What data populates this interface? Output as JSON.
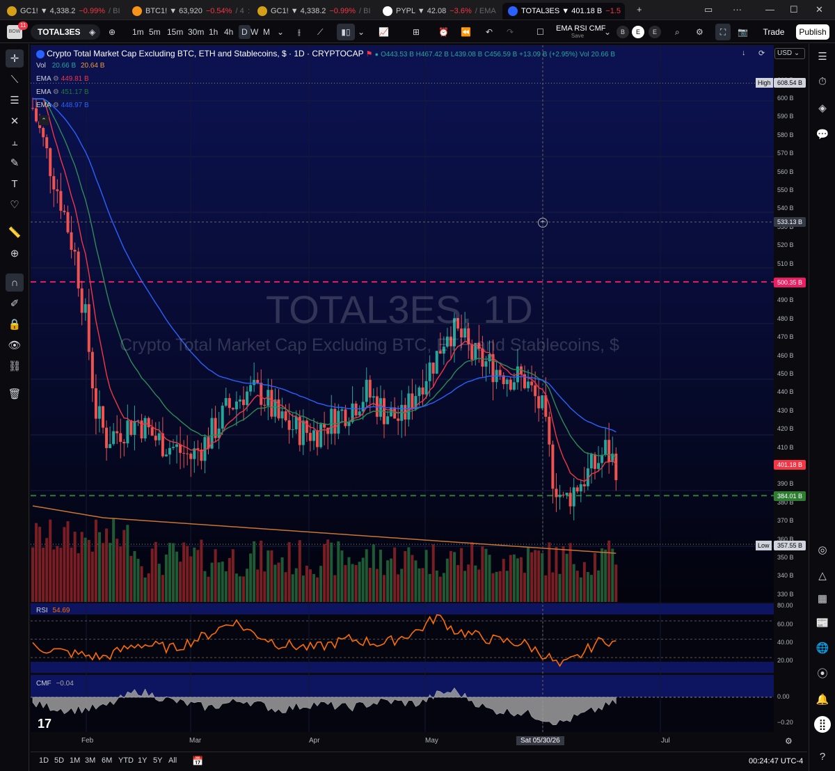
{
  "browser_tabs": [
    {
      "label": "GC1!",
      "price": "4,338.2",
      "change": "−0.99%",
      "extra": "/ BI",
      "color": "#d4a017",
      "active": false
    },
    {
      "label": "BTC1!",
      "price": "63,920",
      "change": "−0.54%",
      "extra": "/ 4",
      "color": "#f7931a",
      "active": false
    },
    {
      "label": "GC1!",
      "price": "4,338.2",
      "change": "−0.99%",
      "extra": "/ BI",
      "color": "#d4a017",
      "active": false
    },
    {
      "label": "PYPL",
      "price": "42.08",
      "change": "−3.6%",
      "extra": "/ EMA",
      "color": "#ffffff",
      "active": false
    },
    {
      "label": "TOTAL3ES",
      "price": "401.18 B",
      "change": "−1.5",
      "extra": "",
      "color": "#2962ff",
      "active": true
    }
  ],
  "toolbar": {
    "avatar_badge": "11",
    "symbol": "TOTAL3ES",
    "intervals": [
      "1m",
      "5m",
      "15m",
      "30m",
      "1h",
      "4h",
      "D",
      "W",
      "M"
    ],
    "active_interval": "D",
    "template_name": "EMA RSI CMF",
    "template_sub": "Save",
    "btn_b": "B",
    "btn_e": "E",
    "trade_label": "Trade",
    "publish_label": "Publish",
    "currency": "USD"
  },
  "legend": {
    "title": "Crypto Total Market Cap Excluding BTC, ETH and Stablecoins, $ · 1D · CRYPTOCAP",
    "ohlc": "O443.53 B  H467.42 B  L439.08 B  C456.59 B  +13.09 B (+2.95%)  Vol 20.66 B",
    "vol_label": "Vol",
    "vol_values": [
      "20.66 B",
      "20.64 B"
    ],
    "ema": [
      {
        "label": "EMA",
        "value": "449.81 B",
        "color": "#f23645"
      },
      {
        "label": "EMA",
        "value": "451.17 B",
        "color": "#1b7a3a"
      },
      {
        "label": "EMA",
        "value": "448.97 B",
        "color": "#2962ff"
      }
    ]
  },
  "watermark": {
    "symbol": "TOTAL3ES, 1D",
    "description": "Crypto Total Market Cap Excluding BTC, ETH and Stablecoins, $"
  },
  "price_scale": {
    "ticks": [
      "610 B",
      "600 B",
      "590 B",
      "580 B",
      "570 B",
      "560 B",
      "550 B",
      "540 B",
      "530 B",
      "520 B",
      "510 B",
      "490 B",
      "480 B",
      "470 B",
      "460 B",
      "450 B",
      "440 B",
      "430 B",
      "420 B",
      "410 B",
      "390 B",
      "380 B",
      "370 B",
      "360 B",
      "350 B",
      "340 B",
      "330 B"
    ],
    "high_label": "High",
    "high_value": "608.54 B",
    "crosshair_value": "533.13 B",
    "resistance_value": "500.35 B",
    "last_value": "401.18 B",
    "support_value": "384.01 B",
    "low_label": "Low",
    "low_value": "357.55 B"
  },
  "rsi": {
    "label": "RSI",
    "value": "54.69",
    "ticks": [
      "80.00",
      "60.00",
      "40.00",
      "20.00"
    ]
  },
  "cmf": {
    "label": "CMF",
    "value": "−0.04",
    "ticks": [
      "0.00",
      "−0.20"
    ]
  },
  "time_axis": {
    "labels": [
      "Feb",
      "Mar",
      "Apr",
      "May",
      "Jul"
    ],
    "cursor_label": "Sat 05/30/26"
  },
  "bottom": {
    "ranges": [
      "1D",
      "5D",
      "1M",
      "3M",
      "6M",
      "YTD",
      "1Y",
      "5Y",
      "All"
    ],
    "clock": "00:24:47 UTC-4"
  },
  "chart_data": {
    "type": "candlestick",
    "series": [
      {
        "name": "EMA",
        "color": "#f23645"
      },
      {
        "name": "EMA",
        "color": "#1b7a3a"
      },
      {
        "name": "EMA",
        "color": "#2962ff"
      }
    ],
    "close_path": [
      [
        0,
        595
      ],
      [
        4,
        570
      ],
      [
        8,
        545
      ],
      [
        12,
        515
      ],
      [
        15,
        480
      ],
      [
        18,
        430
      ],
      [
        21,
        415
      ],
      [
        25,
        420
      ],
      [
        30,
        425
      ],
      [
        35,
        415
      ],
      [
        40,
        410
      ],
      [
        45,
        405
      ],
      [
        50,
        415
      ],
      [
        55,
        430
      ],
      [
        60,
        440
      ],
      [
        65,
        440
      ],
      [
        70,
        425
      ],
      [
        75,
        420
      ],
      [
        80,
        418
      ],
      [
        85,
        425
      ],
      [
        90,
        432
      ],
      [
        95,
        440
      ],
      [
        100,
        430
      ],
      [
        105,
        425
      ],
      [
        110,
        445
      ],
      [
        115,
        460
      ],
      [
        118,
        475
      ],
      [
        122,
        470
      ],
      [
        125,
        460
      ],
      [
        130,
        455
      ],
      [
        135,
        450
      ],
      [
        140,
        447
      ],
      [
        145,
        430
      ],
      [
        148,
        395
      ],
      [
        151,
        380
      ],
      [
        155,
        390
      ],
      [
        160,
        400
      ],
      [
        163,
        409
      ],
      [
        166,
        401
      ]
    ],
    "horizontal_levels": [
      608.54,
      500.35,
      384.01,
      357.55
    ],
    "rsi_path": [
      [
        0,
        42
      ],
      [
        10,
        35
      ],
      [
        20,
        30
      ],
      [
        30,
        45
      ],
      [
        40,
        40
      ],
      [
        50,
        55
      ],
      [
        57,
        70
      ],
      [
        62,
        58
      ],
      [
        70,
        45
      ],
      [
        80,
        40
      ],
      [
        90,
        50
      ],
      [
        100,
        45
      ],
      [
        110,
        60
      ],
      [
        115,
        75
      ],
      [
        120,
        60
      ],
      [
        130,
        50
      ],
      [
        140,
        45
      ],
      [
        147,
        30
      ],
      [
        150,
        20
      ],
      [
        155,
        30
      ],
      [
        160,
        45
      ],
      [
        163,
        50
      ],
      [
        166,
        45
      ]
    ],
    "cmf_path": [
      [
        0,
        -0.05
      ],
      [
        10,
        -0.1
      ],
      [
        20,
        -0.08
      ],
      [
        30,
        0.05
      ],
      [
        40,
        -0.03
      ],
      [
        50,
        -0.08
      ],
      [
        60,
        -0.02
      ],
      [
        70,
        -0.1
      ],
      [
        80,
        -0.05
      ],
      [
        90,
        -0.08
      ],
      [
        100,
        -0.03
      ],
      [
        110,
        -0.05
      ],
      [
        115,
        0.02
      ],
      [
        120,
        0.05
      ],
      [
        130,
        -0.1
      ],
      [
        140,
        -0.12
      ],
      [
        150,
        -0.2
      ],
      [
        160,
        -0.1
      ],
      [
        166,
        -0.04
      ]
    ]
  }
}
